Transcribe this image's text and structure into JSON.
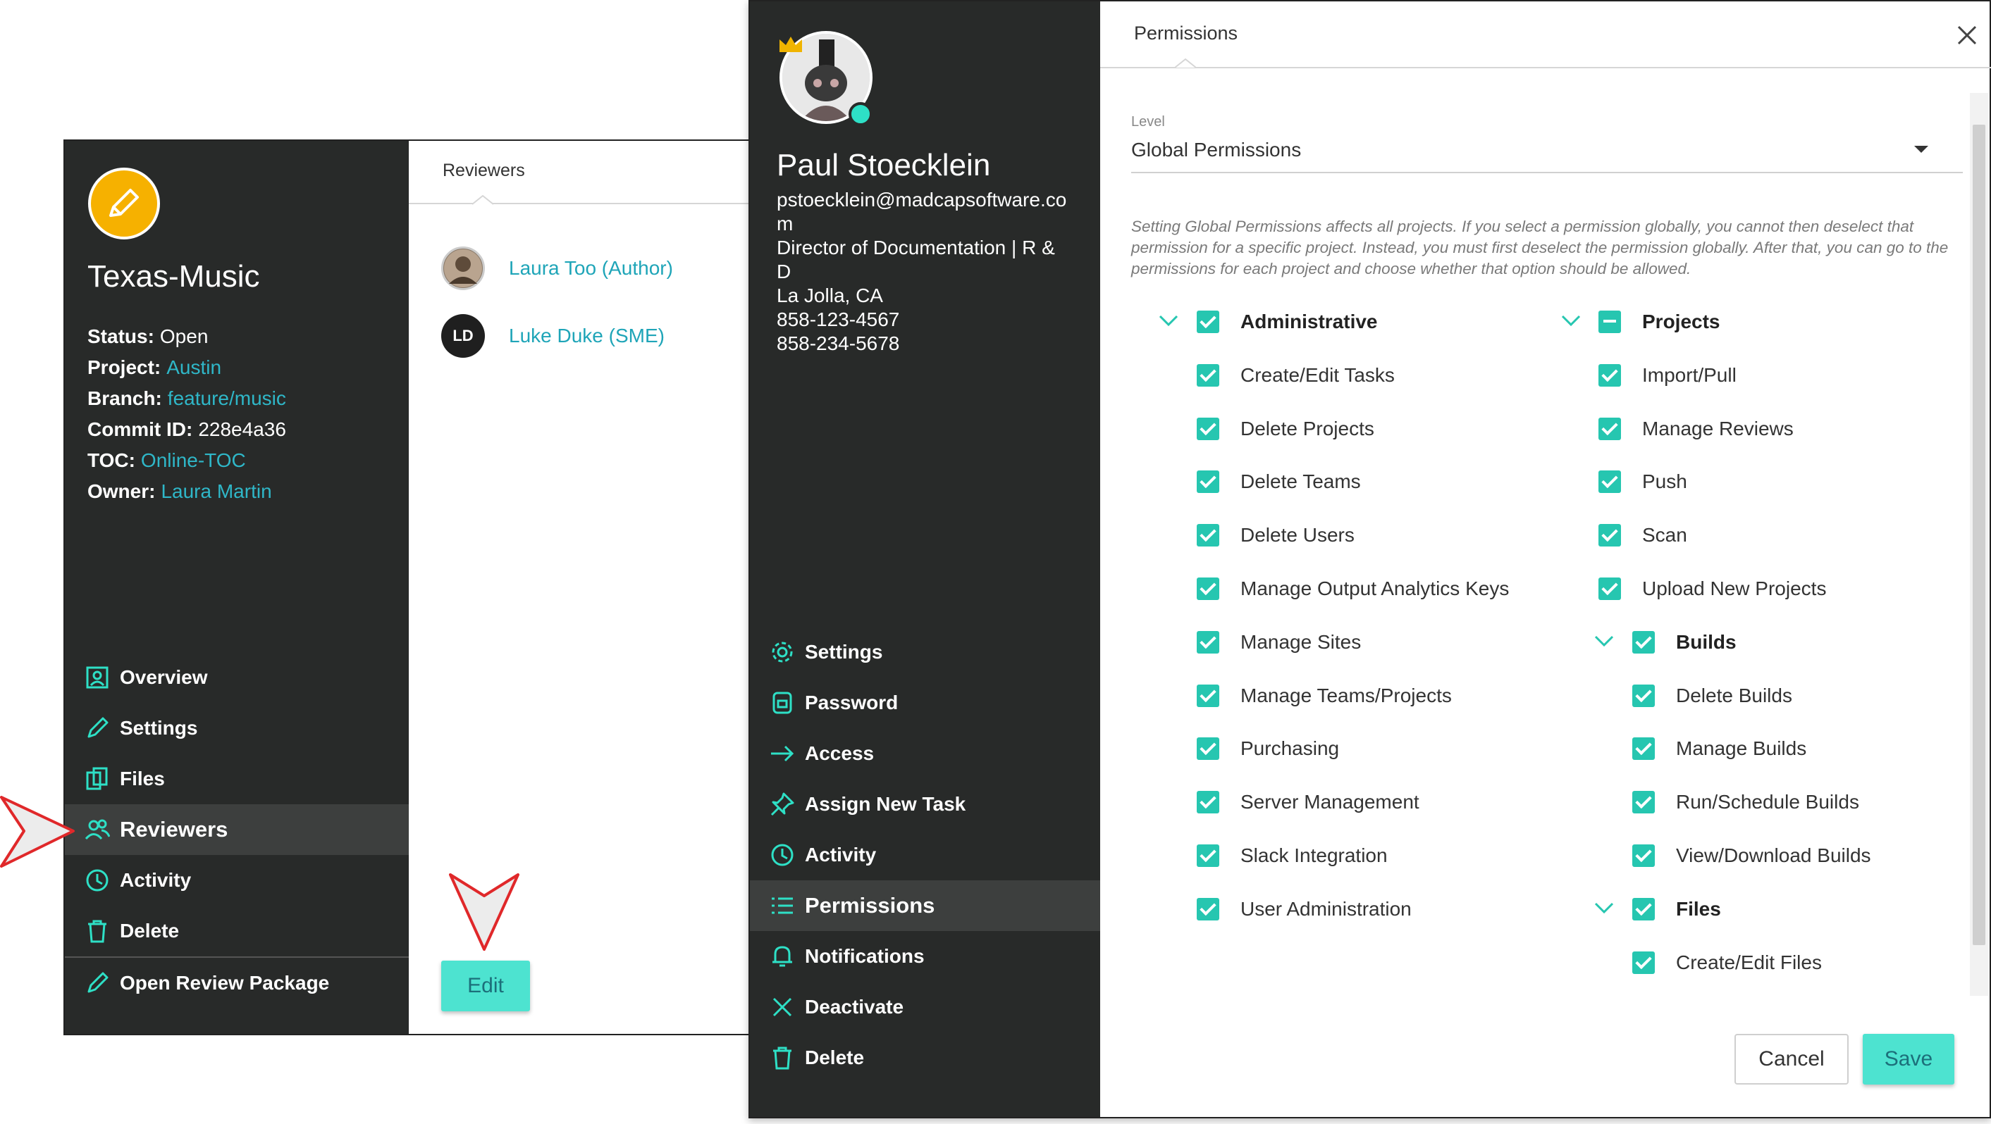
{
  "review": {
    "title": "Texas-Music",
    "meta": [
      {
        "key": "Status:",
        "value": "Open",
        "link": false
      },
      {
        "key": "Project:",
        "value": "Austin",
        "link": true
      },
      {
        "key": "Branch:",
        "value": "feature/music",
        "link": true
      },
      {
        "key": "Commit ID:",
        "value": "228e4a36",
        "link": false
      },
      {
        "key": "TOC:",
        "value": "Online-TOC",
        "link": true
      },
      {
        "key": "Owner:",
        "value": "Laura Martin",
        "link": true
      }
    ],
    "nav": [
      "Overview",
      "Settings",
      "Files",
      "Reviewers",
      "Activity",
      "Delete"
    ],
    "active_nav": "Reviewers",
    "open_package": "Open Review Package",
    "tab": "Reviewers",
    "reviewers": [
      {
        "name": "Laura Too (Author)",
        "initials": ""
      },
      {
        "name": "Luke Duke (SME)",
        "initials": "LD"
      }
    ],
    "edit_label": "Edit"
  },
  "user": {
    "name": "Paul Stoecklein",
    "email": "pstoecklein@madcapsoftware.com",
    "title": "Director of Documentation | R & D",
    "location": "La Jolla, CA",
    "phone1": "858-123-4567",
    "phone2": "858-234-5678",
    "nav": [
      "Settings",
      "Password",
      "Access",
      "Assign New Task",
      "Activity",
      "Permissions",
      "Notifications",
      "Deactivate",
      "Delete"
    ],
    "active_nav": "Permissions"
  },
  "permissions": {
    "tab": "Permissions",
    "level_label": "Level",
    "level_value": "Global Permissions",
    "note": "Setting Global Permissions affects all projects. If you select a permission globally, you cannot then deselect that permission for a specific project. Instead, you must first deselect the permission globally. After that, you can go to the permissions for each project and choose whether that option should be allowed.",
    "administrative": {
      "label": "Administrative",
      "items": [
        "Create/Edit Tasks",
        "Delete Projects",
        "Delete Teams",
        "Delete Users",
        "Manage Output Analytics Keys",
        "Manage Sites",
        "Manage Teams/Projects",
        "Purchasing",
        "Server Management",
        "Slack Integration",
        "User Administration"
      ]
    },
    "projects": {
      "label": "Projects",
      "items": [
        "Import/Pull",
        "Manage Reviews",
        "Push",
        "Scan",
        "Upload New Projects"
      ]
    },
    "builds": {
      "label": "Builds",
      "items": [
        "Delete Builds",
        "Manage Builds",
        "Run/Schedule Builds",
        "View/Download Builds"
      ]
    },
    "files": {
      "label": "Files",
      "items": [
        "Create/Edit Files"
      ]
    },
    "cancel_label": "Cancel",
    "save_label": "Save"
  },
  "colors": {
    "sidebar": "#282a29",
    "accent": "#26c6b0",
    "link": "#2fb7c8",
    "button": "#4de3d0",
    "callout": "#e0282a"
  },
  "icons": [
    "pencil-icon",
    "overview-icon",
    "settings-icon",
    "files-icon",
    "reviewers-icon",
    "activity-icon",
    "delete-icon",
    "gear-icon",
    "lock-icon",
    "arrow-right-icon",
    "pin-icon",
    "list-icon",
    "bell-icon",
    "close-icon",
    "crown-icon",
    "chevron-down-icon"
  ]
}
